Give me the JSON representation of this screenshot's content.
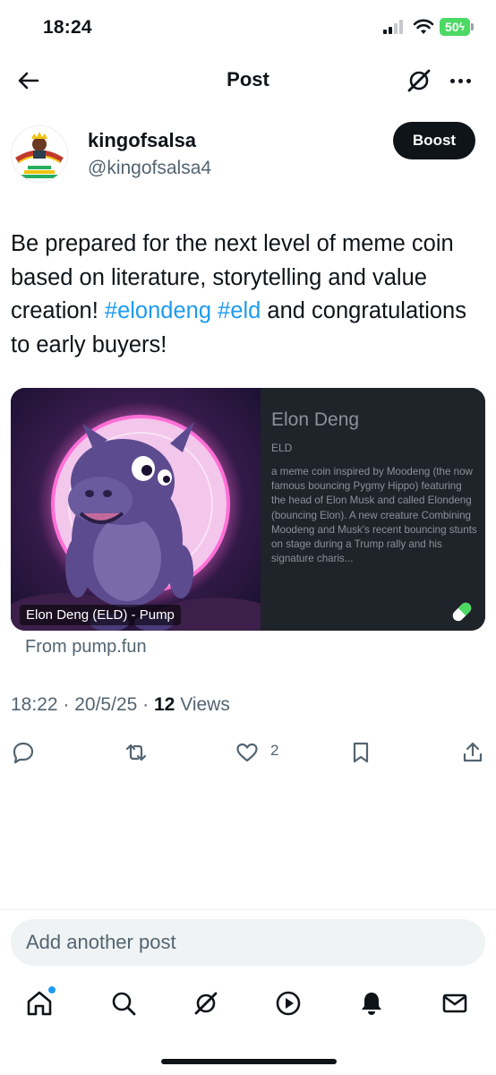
{
  "status": {
    "time": "18:24",
    "battery": "50"
  },
  "header": {
    "title": "Post"
  },
  "author": {
    "name": "kingofsalsa",
    "handle": "@kingofsalsa4",
    "boost_label": "Boost"
  },
  "post": {
    "text_1": "Be prepared for the next level of meme coin based on literature, storytelling and value creation! ",
    "tag_1": "#elondeng",
    "tag_2": "#eld",
    "text_2": " and congratulations to early buyers!"
  },
  "card": {
    "image_label": "Elon Deng (ELD) - Pump",
    "title": "Elon Deng",
    "ticker": "ELD",
    "description": "a meme coin inspired by Moodeng (the now famous bouncing Pygmy Hippo) featuring the head of Elon Musk and called Elondeng (bouncing Elon). A new creature Combining Moodeng and Musk's recent bouncing stunts on stage during a Trump rally and his signature charis...",
    "source": "From pump.fun"
  },
  "meta": {
    "time": "18:22",
    "date": "20/5/25",
    "views_count": "12",
    "views_label": "Views"
  },
  "actions": {
    "like_count": "2"
  },
  "reply": {
    "placeholder": "Add another post"
  },
  "colors": {
    "accent": "#1d9bf0",
    "text": "#0f1419",
    "muted": "#536471"
  }
}
